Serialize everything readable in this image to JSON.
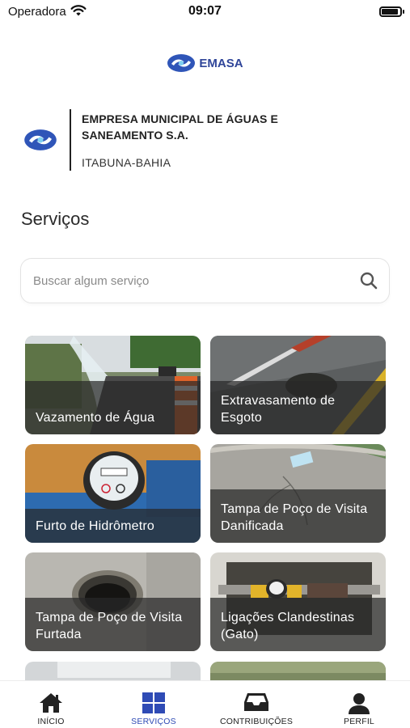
{
  "status_bar": {
    "carrier": "Operadora",
    "time": "09:07"
  },
  "header": {
    "logo_text": "EMASA"
  },
  "company": {
    "name": "EMPRESA MUNICIPAL DE  ÁGUAS E SANEAMENTO S.A.",
    "city": "ITABUNA-BAHIA"
  },
  "services": {
    "title": "Serviços",
    "search_placeholder": "Buscar algum serviço",
    "items": [
      {
        "label": "Vazamento de Água"
      },
      {
        "label": "Extravasamento de Esgoto"
      },
      {
        "label": "Furto de Hidrômetro"
      },
      {
        "label": "Tampa de Poço de Visita Danificada"
      },
      {
        "label": "Tampa de Poço de Visita Furtada"
      },
      {
        "label": "Ligações Clandestinas (Gato)"
      }
    ]
  },
  "tab_bar": {
    "active_color": "#2f4bb5",
    "tabs": [
      {
        "label": "INÍCIO",
        "icon": "home-icon"
      },
      {
        "label": "SERVIÇOS",
        "icon": "grid-icon"
      },
      {
        "label": "CONTRIBUIÇÕES",
        "icon": "inbox-icon"
      },
      {
        "label": "PERFIL",
        "icon": "user-icon"
      }
    ]
  }
}
